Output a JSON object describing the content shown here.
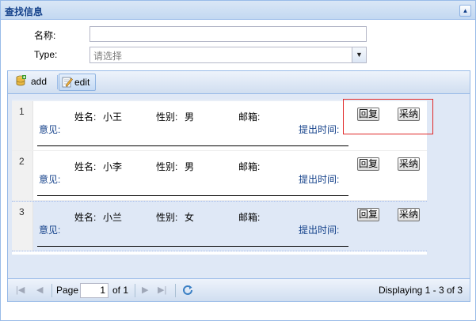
{
  "panel": {
    "title": "查找信息"
  },
  "form": {
    "name_label": "名称:",
    "type_label": "Type:",
    "type_placeholder": "请选择"
  },
  "toolbar": {
    "add_label": "add",
    "edit_label": "edit"
  },
  "rows": [
    {
      "num": "1",
      "name_label": "姓名:",
      "name": "小王",
      "gender_label": "性别:",
      "gender": "男",
      "email_label": "邮箱:",
      "opinion_label": "意见:",
      "time_label": "提出时间:",
      "reply": "回复",
      "adopt": "采纳"
    },
    {
      "num": "2",
      "name_label": "姓名:",
      "name": "小李",
      "gender_label": "性别:",
      "gender": "男",
      "email_label": "邮箱:",
      "opinion_label": "意见:",
      "time_label": "提出时间:",
      "reply": "回复",
      "adopt": "采纳"
    },
    {
      "num": "3",
      "name_label": "姓名:",
      "name": "小兰",
      "gender_label": "性别:",
      "gender": "女",
      "email_label": "邮箱:",
      "opinion_label": "意见:",
      "time_label": "提出时间:",
      "reply": "回复",
      "adopt": "采纳"
    }
  ],
  "pager": {
    "page_label": "Page",
    "current_page": "1",
    "of_label": "of 1",
    "display_msg": "Displaying 1 - 3 of 3"
  },
  "colors": {
    "header_bg": "#c3d8f1",
    "border": "#99bbe8",
    "title": "#15428b",
    "highlight": "#e12828"
  }
}
